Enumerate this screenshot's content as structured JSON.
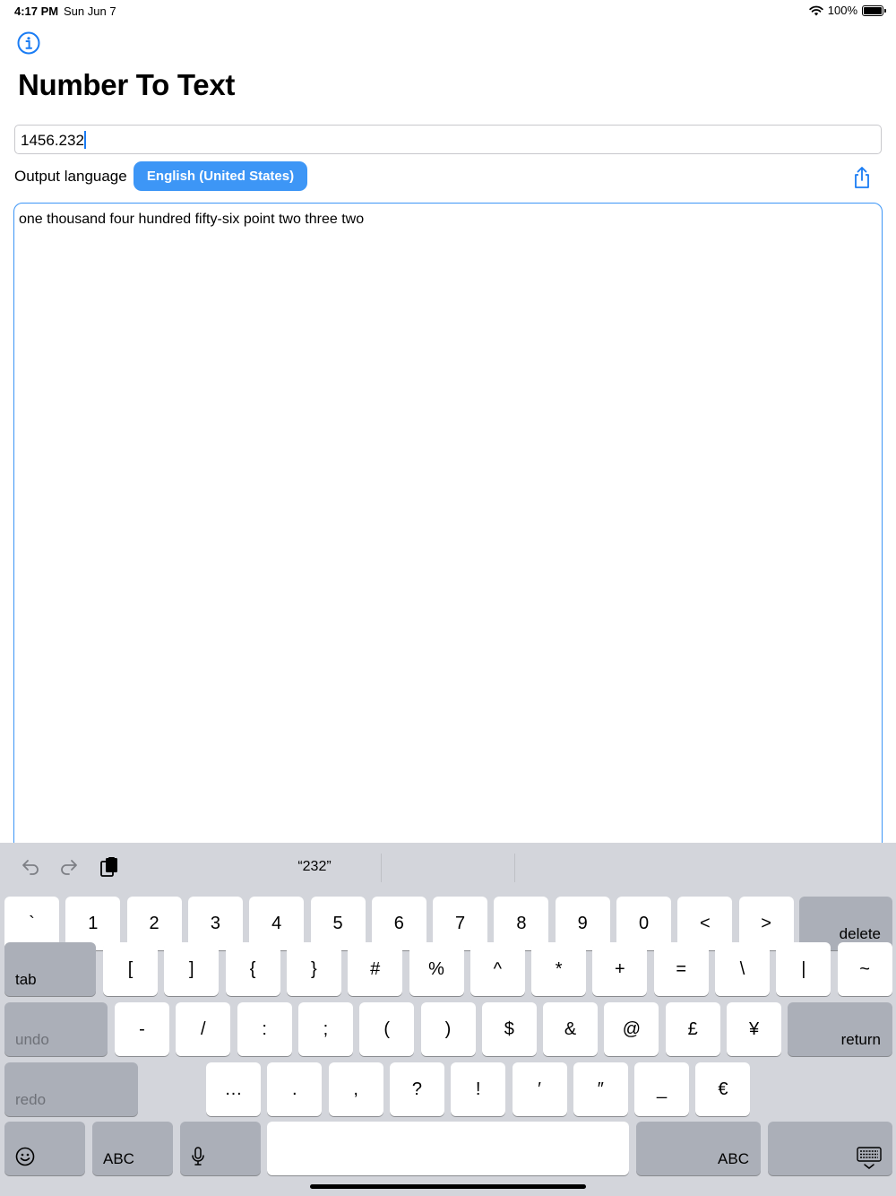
{
  "status_bar": {
    "time": "4:17 PM",
    "date": "Sun Jun 7",
    "battery": "100%",
    "battery_level": 1.0
  },
  "app": {
    "title": "Number To Text",
    "info_icon": "info-circle-icon"
  },
  "number_input": {
    "value": "1456.232"
  },
  "language": {
    "label": "Output language",
    "selected": "English (United States)"
  },
  "share_icon": "share-icon",
  "output_text": "one thousand four hundred fifty-six point two three two",
  "accent_color": "#3d96f6",
  "keyboard": {
    "shortcuts": {
      "undo_icon": "undo-arrow-icon",
      "redo_icon": "redo-arrow-icon",
      "paste_icon": "clipboard-paste-icon"
    },
    "suggestion": "“232”",
    "row1": [
      "`",
      "1",
      "2",
      "3",
      "4",
      "5",
      "6",
      "7",
      "8",
      "9",
      "0",
      "<",
      ">"
    ],
    "delete": "delete",
    "tab": "tab",
    "row2": [
      "[",
      "]",
      "{",
      "}",
      "#",
      "%",
      "^",
      "*",
      "+",
      "=",
      "\\",
      "|",
      "~"
    ],
    "undo": "undo",
    "row3": [
      "-",
      "/",
      ":",
      ";",
      "(",
      ")",
      "$",
      "&",
      "@",
      "£",
      "¥"
    ],
    "return": "return",
    "redo": "redo",
    "row4": [
      "…",
      ".",
      ",",
      "?",
      "!",
      "′",
      "″",
      "_",
      "€"
    ],
    "emoji_icon": "emoji-smiley-icon",
    "abc_left": "ABC",
    "mic_icon": "microphone-icon",
    "abc_right": "ABC",
    "dismiss_icon": "keyboard-dismiss-icon"
  }
}
